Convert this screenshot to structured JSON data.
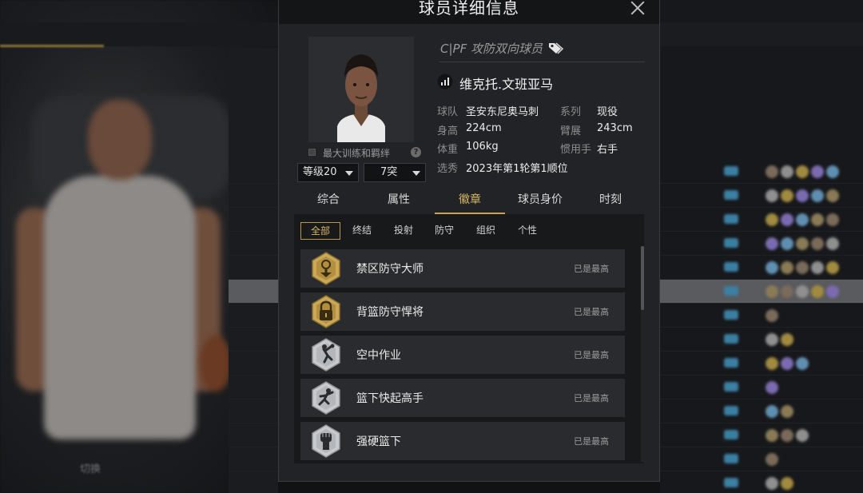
{
  "modal": {
    "title": "球员详细信息",
    "max_training_label": "最大训练和羁绊",
    "level_select": "等级20",
    "breakthrough_select": "7突"
  },
  "player": {
    "position": "C|PF 攻防双向球员",
    "name": "维克托.文班亚马",
    "info": [
      {
        "key": "球队",
        "value": "圣安东尼奥马刺"
      },
      {
        "key": "系列",
        "value": "现役"
      },
      {
        "key": "身高",
        "value": "224cm"
      },
      {
        "key": "臂展",
        "value": "243cm"
      },
      {
        "key": "体重",
        "value": "106kg"
      },
      {
        "key": "惯用手",
        "value": "右手"
      },
      {
        "key": "选秀",
        "value": "2023年第1轮第1顺位"
      }
    ]
  },
  "tabs": [
    {
      "label": "综合",
      "active": false
    },
    {
      "label": "属性",
      "active": false
    },
    {
      "label": "徽章",
      "active": true
    },
    {
      "label": "球员身价",
      "active": false
    },
    {
      "label": "时刻",
      "active": false
    }
  ],
  "filters": [
    {
      "label": "全部",
      "active": true
    },
    {
      "label": "终结",
      "active": false
    },
    {
      "label": "投射",
      "active": false
    },
    {
      "label": "防守",
      "active": false
    },
    {
      "label": "组织",
      "active": false
    },
    {
      "label": "个性",
      "active": false
    }
  ],
  "badges": [
    {
      "name": "禁区防守大师",
      "status": "已是最高",
      "tier": "gold",
      "icon": "paint-defender-icon"
    },
    {
      "name": "背篮防守悍将",
      "status": "已是最高",
      "tier": "gold",
      "icon": "lock-icon"
    },
    {
      "name": "空中作业",
      "status": "已是最高",
      "tier": "silver",
      "icon": "dunk-icon"
    },
    {
      "name": "篮下快起高手",
      "status": "已是最高",
      "tier": "silver",
      "icon": "jumper-icon"
    },
    {
      "name": "强硬篮下",
      "status": "已是最高",
      "tier": "silver",
      "icon": "fist-icon"
    }
  ],
  "colors": {
    "accent": "#c8a351",
    "panel": "#222326",
    "gold_badge": "#c9a85a",
    "silver_badge": "#c7c9cc"
  },
  "background": {
    "control_label": "切换"
  }
}
